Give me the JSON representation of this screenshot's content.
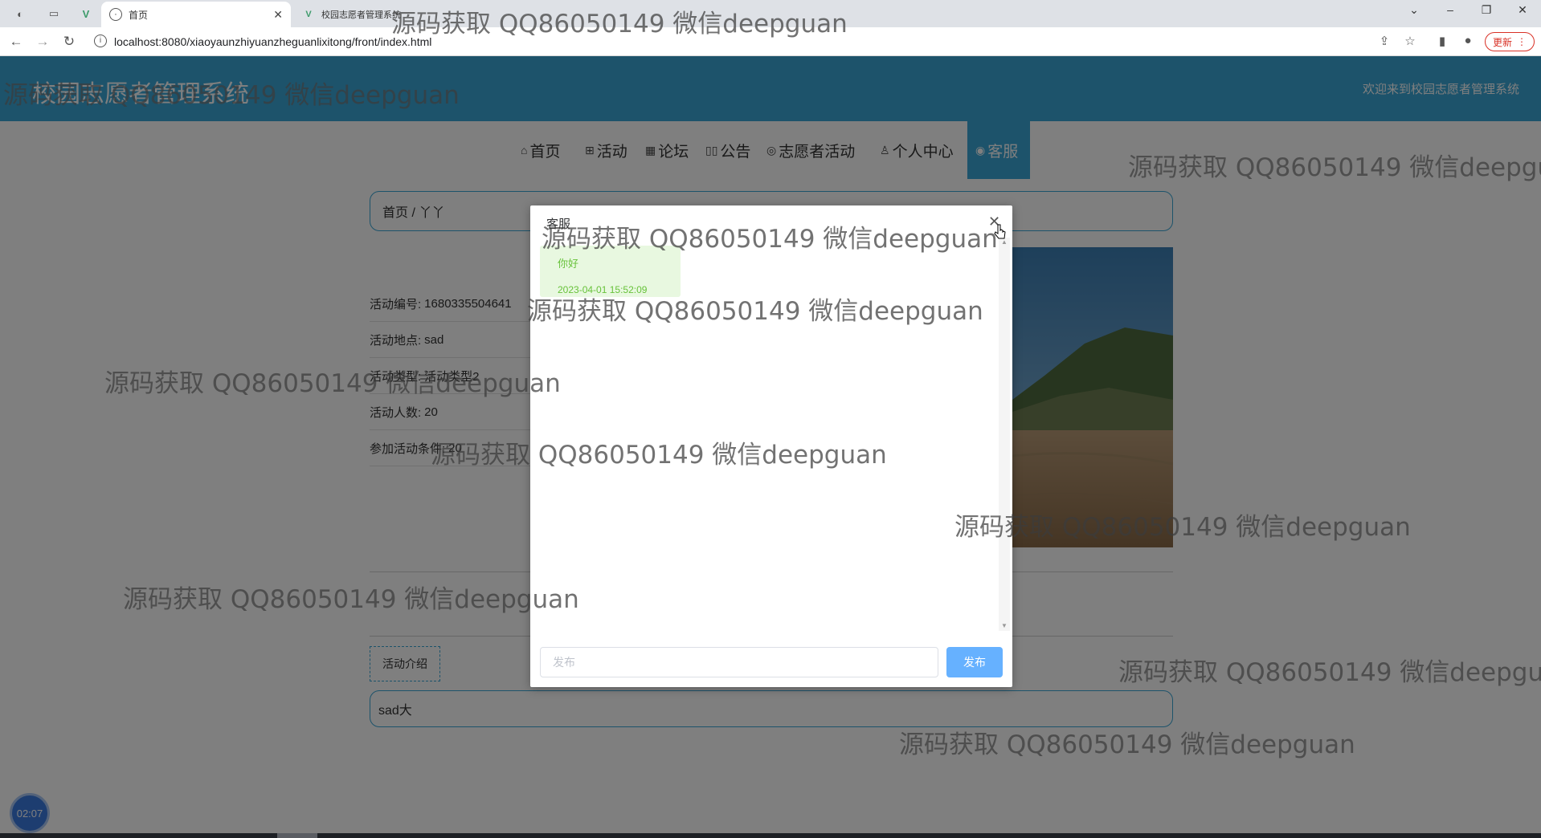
{
  "browser": {
    "tabs": [
      {
        "label": "首页",
        "active": true
      },
      {
        "label": "校园志愿者管理系统",
        "active": false
      }
    ],
    "url": "localhost:8080/xiaoyaunzhiyuanzheguanlixitong/front/index.html",
    "update_label": "更新"
  },
  "site": {
    "title": "校园志愿者管理系统",
    "welcome": "欢迎来到校园志愿者管理系统"
  },
  "nav": {
    "items": [
      {
        "label": "首页",
        "icon": "home-icon"
      },
      {
        "label": "活动",
        "icon": "grid-icon"
      },
      {
        "label": "论坛",
        "icon": "apps-icon"
      },
      {
        "label": "公告",
        "icon": "book-icon"
      },
      {
        "label": "志愿者活动",
        "icon": "palette-icon"
      },
      {
        "label": "个人中心",
        "icon": "user-icon"
      },
      {
        "label": "客服",
        "icon": "chat-icon",
        "active": true
      }
    ]
  },
  "breadcrumb": "首页 / 丫丫",
  "detail": {
    "rows": [
      {
        "label": "活动编号:",
        "value": "1680335504641"
      },
      {
        "label": "活动地点:",
        "value": "sad"
      },
      {
        "label": "活动类型:",
        "value": "活动类型2"
      },
      {
        "label": "活动人数:",
        "value": "20"
      },
      {
        "label": "参加活动条件:",
        "value": "20"
      }
    ],
    "intro_tab": "活动介绍",
    "intro_text": "sad大"
  },
  "timer": "02:07",
  "modal": {
    "title": "客服",
    "messages": [
      {
        "text": "你好",
        "time": "2023-04-01 15:52:09"
      }
    ],
    "input_placeholder": "发布",
    "send_label": "发布"
  },
  "watermark_text": "源码获取 QQ86050149 微信deepguan",
  "colors": {
    "brand": "#3aa6d6",
    "send_button": "#66b1ff",
    "chat_bubble": "#e8f8e0",
    "chat_text": "#67c23a"
  }
}
